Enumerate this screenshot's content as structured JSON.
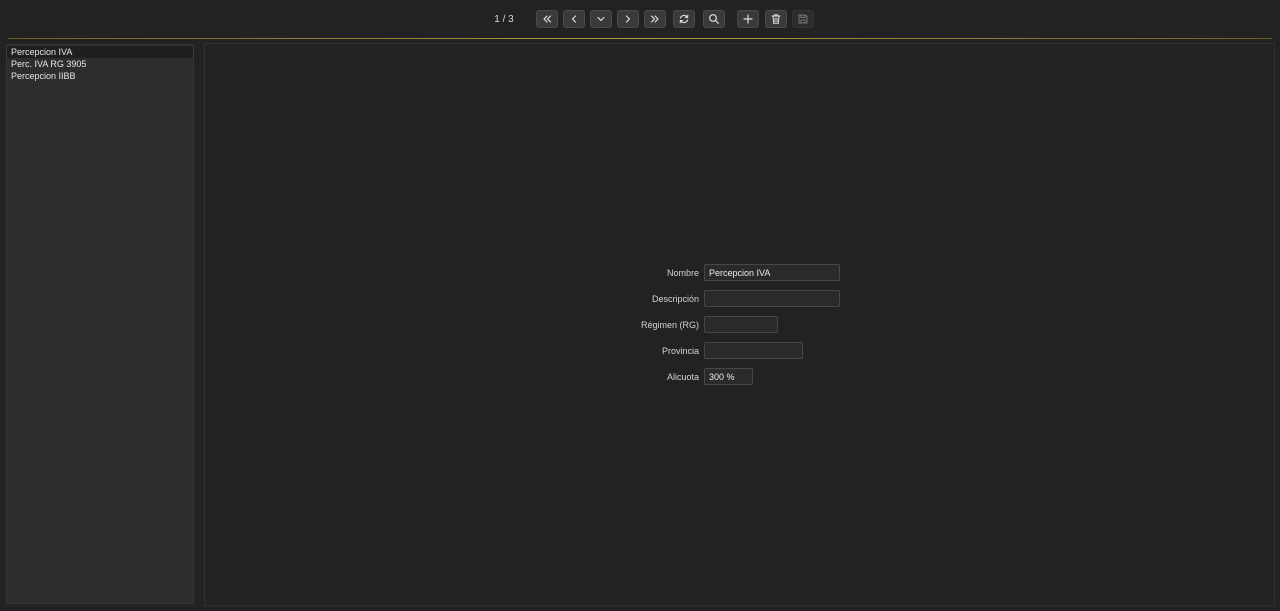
{
  "toolbar": {
    "counter": "1 / 3",
    "buttons": [
      {
        "name": "first-record-button",
        "icon": "double-chevron-left-icon"
      },
      {
        "name": "previous-record-button",
        "icon": "chevron-left-icon"
      },
      {
        "name": "dropdown-button",
        "icon": "chevron-down-icon"
      },
      {
        "name": "next-record-button",
        "icon": "chevron-right-icon"
      },
      {
        "name": "last-record-button",
        "icon": "double-chevron-right-icon"
      },
      {
        "name": "refresh-button",
        "icon": "refresh-icon"
      },
      {
        "name": "search-button",
        "icon": "search-icon"
      },
      {
        "name": "add-button",
        "icon": "plus-icon"
      },
      {
        "name": "delete-button",
        "icon": "trash-icon"
      },
      {
        "name": "save-button",
        "icon": "save-icon",
        "disabled": true
      }
    ]
  },
  "sidebar": {
    "items": [
      {
        "label": "Percepcion IVA",
        "selected": true
      },
      {
        "label": "Perc. IVA RG 3905",
        "selected": false
      },
      {
        "label": "Percepcion IIBB",
        "selected": false
      }
    ]
  },
  "form": {
    "nombre": {
      "label": "Nombre",
      "value": "Percepcion IVA"
    },
    "descripcion": {
      "label": "Descripción",
      "value": ""
    },
    "regimen": {
      "label": "Régimen (RG)",
      "value": ""
    },
    "provincia": {
      "label": "Provincia",
      "value": ""
    },
    "alicuota": {
      "label": "Alicuota",
      "value": "300 %"
    }
  },
  "colors": {
    "accent_line": "#b39b3e",
    "background": "#222222",
    "sidebar_bg": "#2d2d2d"
  }
}
